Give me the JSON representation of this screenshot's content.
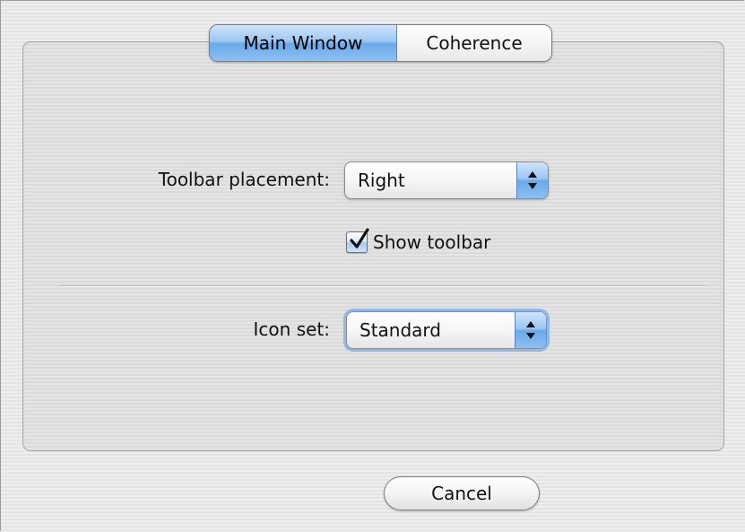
{
  "tabs": [
    {
      "label": "Main Window",
      "selected": true
    },
    {
      "label": "Coherence",
      "selected": false
    }
  ],
  "toolbar_placement": {
    "label": "Toolbar placement:",
    "value": "Right"
  },
  "show_toolbar": {
    "label": "Show toolbar",
    "checked": true
  },
  "icon_set": {
    "label": "Icon set:",
    "value": "Standard"
  },
  "buttons": {
    "cancel": "Cancel"
  },
  "colors": {
    "accent": "#6aa9ea",
    "background": "#ececec",
    "panel": "#e2e2e2"
  },
  "icons": {
    "popup_arrows": "up-down-arrows-icon",
    "checkmark": "checkmark-icon"
  }
}
